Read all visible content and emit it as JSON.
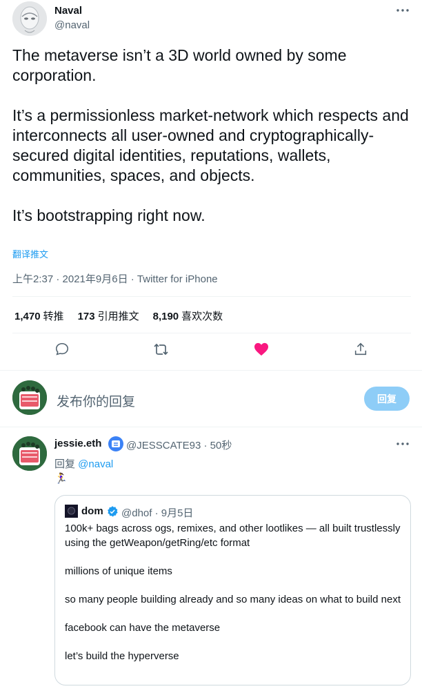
{
  "tweet": {
    "author_name": "Naval",
    "author_handle": "@naval",
    "text": "The metaverse isn’t a 3D world owned by some corporation.\n\nIt’s a permissionless market-network which respects and interconnects all user-owned and cryptographically-secured digital identities, reputations, wallets, communities, spaces, and objects.\n\nIt’s bootstrapping right now.",
    "translate_label": "翻译推文",
    "meta": "上午2:37 · 2021年9月6日 · Twitter for iPhone"
  },
  "stats": [
    {
      "num": "1,470",
      "label": "转推"
    },
    {
      "num": "173",
      "label": "引用推文"
    },
    {
      "num": "8,190",
      "label": "喜欢次数"
    }
  ],
  "actions": {
    "reply_icon": "reply-icon",
    "retweet_icon": "retweet-icon",
    "like_icon": "heart-icon",
    "share_icon": "share-icon",
    "like_color": "#f91880"
  },
  "compose": {
    "placeholder": "发布你的回复",
    "button_label": "回复",
    "button_color": "#8ecdf7"
  },
  "reply": {
    "name": "jessie.eth",
    "meta": "@JESSCATE93 · 50秒",
    "reply_to_prefix": "回复 ",
    "reply_to_handle": "@naval",
    "emoji": "🏃‍♀️",
    "quote": {
      "name": "dom",
      "meta": "@dhof · 9月5日",
      "text": "100k+ bags across ogs, remixes, and other lootlikes — all built trustlessly using the getWeapon/getRing/etc format\n\nmillions of unique items\n\nso many people building already and so many ideas on what to build next\n\nfacebook can have the metaverse\n\nlet’s build the hyperverse"
    }
  }
}
